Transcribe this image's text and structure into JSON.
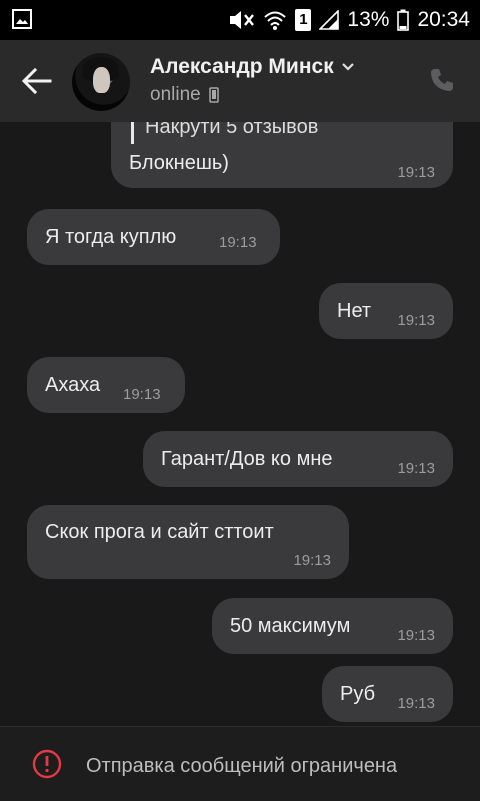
{
  "status_bar": {
    "battery_percent": "13%",
    "time": "20:34",
    "sim_label": "1",
    "icons": [
      "gallery-icon",
      "mute-icon",
      "wifi-icon",
      "sim-icon",
      "signal-icon",
      "battery-icon"
    ]
  },
  "header": {
    "name": "Александр Минск",
    "status": "online",
    "icons": [
      "back-arrow-icon",
      "chevron-down-icon",
      "mobile-device-icon",
      "phone-icon"
    ]
  },
  "messages": [
    {
      "side": "out",
      "quote": "Накрути 5 отзывов",
      "text": "Блокнешь)",
      "time": "19:13"
    },
    {
      "side": "in",
      "text": "Я тогда куплю",
      "time": "19:13"
    },
    {
      "side": "out",
      "text": "Нет",
      "time": "19:13"
    },
    {
      "side": "in",
      "text": "Ахаха",
      "time": "19:13"
    },
    {
      "side": "out",
      "text": "Гарант/Дов ко мне",
      "time": "19:13"
    },
    {
      "side": "in",
      "text": "Скок прога и сайт сттоит",
      "time": "19:13"
    },
    {
      "side": "out",
      "text": "50 максимум",
      "time": "19:13"
    },
    {
      "side": "out",
      "text": "Руб",
      "time": "19:13"
    }
  ],
  "footer": {
    "text": "Отправка сообщений ограничена",
    "icon": "warning-circle-icon",
    "accent": "#e53945"
  }
}
